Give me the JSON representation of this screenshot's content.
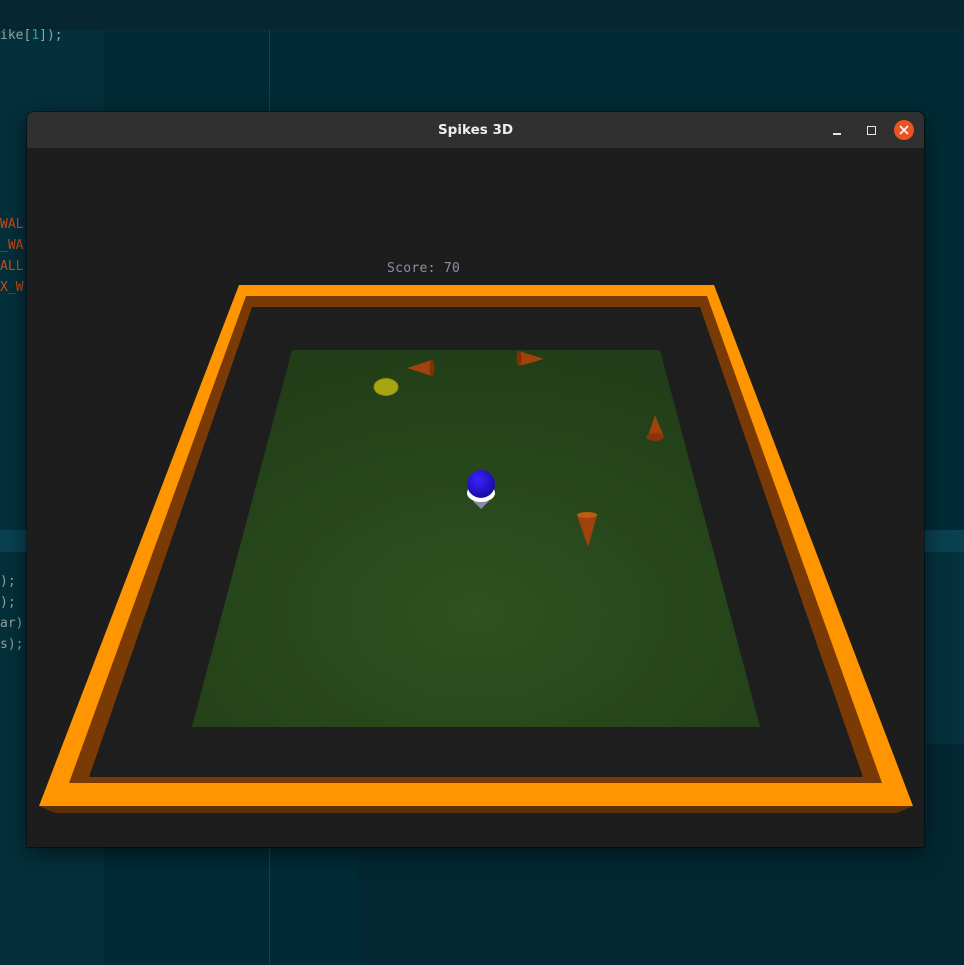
{
  "editor": {
    "lines": [
      {
        "text": "ike[",
        "num": "1",
        "rest": "]);",
        "color": "normal"
      },
      {
        "text": "WAL",
        "color": "red"
      },
      {
        "text": "_WA",
        "color": "red"
      },
      {
        "text": "ALL",
        "color": "red"
      },
      {
        "text": "X_W",
        "color": "red"
      },
      {
        "text": ");",
        "color": "normal"
      },
      {
        "text": ");",
        "color": "normal"
      },
      {
        "text": "ar)",
        "color": "normal"
      },
      {
        "text": "s);",
        "color": "normal"
      }
    ]
  },
  "window": {
    "title": "Spikes 3D",
    "controls": {
      "minimize": "minimize",
      "maximize": "maximize",
      "close": "close"
    }
  },
  "game": {
    "score_label": "Score: 70",
    "colors": {
      "wall_top": "#ff9500",
      "wall_inner": "#7a3a05",
      "floor": "#2a4a1c",
      "background": "#1d1d1d",
      "player": "#2a10e0",
      "coin": "#a8a610",
      "spike": "#a0420a"
    },
    "entities": {
      "player": "blue-sphere",
      "coin": "yellow-coin",
      "spikes": [
        "spike",
        "spike",
        "spike",
        "spike"
      ]
    }
  }
}
